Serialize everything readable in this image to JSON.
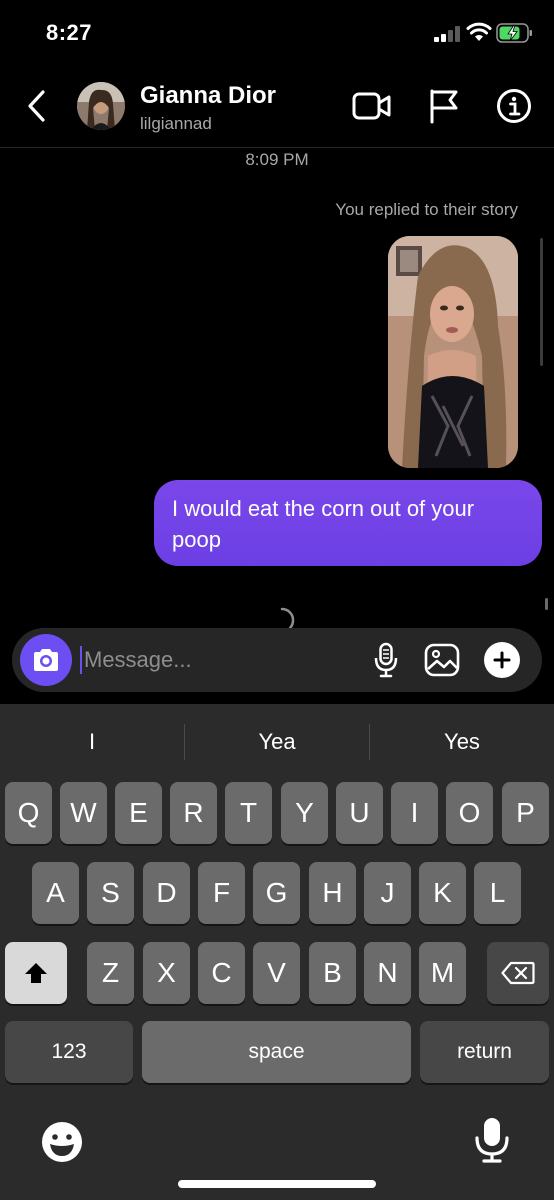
{
  "status_bar": {
    "time": "8:27"
  },
  "header": {
    "contact_name": "Gianna Dior",
    "contact_handle": "lilgiannad",
    "icons": [
      "back-chevron-icon",
      "video-camera-icon",
      "flag-icon",
      "info-icon"
    ]
  },
  "conversation": {
    "timestamp": "8:09 PM",
    "story_note": "You replied to their story",
    "message_text": "I would eat the corn out of your poop"
  },
  "composer": {
    "placeholder": "Message...",
    "value": ""
  },
  "keyboard": {
    "suggestions": [
      "I",
      "Yea",
      "Yes"
    ],
    "row1": [
      "Q",
      "W",
      "E",
      "R",
      "T",
      "Y",
      "U",
      "I",
      "O",
      "P"
    ],
    "row2": [
      "A",
      "S",
      "D",
      "F",
      "G",
      "H",
      "J",
      "K",
      "L"
    ],
    "row3": [
      "Z",
      "X",
      "C",
      "V",
      "B",
      "N",
      "M"
    ],
    "numbers_label": "123",
    "space_label": "space",
    "return_label": "return"
  },
  "colors": {
    "accent": "#6d4ef2",
    "bubble_top": "#7a47ea",
    "background": "#000000",
    "keyboard_bg": "#2b2b2b",
    "key_bg": "#6b6b6b",
    "battery_green": "#4cd964"
  }
}
